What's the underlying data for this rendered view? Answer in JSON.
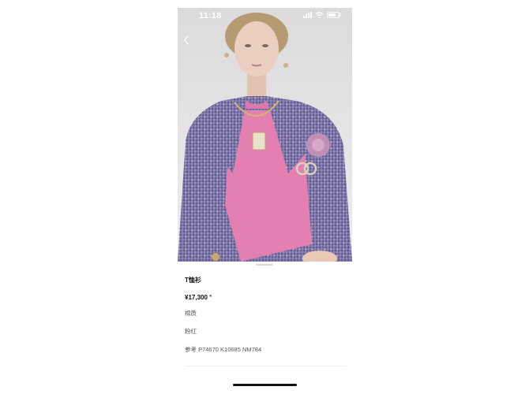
{
  "status_bar": {
    "time": "11:18"
  },
  "product": {
    "title": "T恤衫",
    "price": "¥17,300",
    "material": "棉质",
    "color": "粉红",
    "reference": "参考 P74670 K10685 NM784"
  },
  "icons": {
    "back": "chevron-left-icon",
    "signal": "signal-icon",
    "wifi": "wifi-icon",
    "battery": "battery-icon",
    "price_info": "info-icon"
  },
  "colors": {
    "tweed": "#5b5f96",
    "tshirt": "#e37fb1",
    "background": "#e6e4e5"
  }
}
